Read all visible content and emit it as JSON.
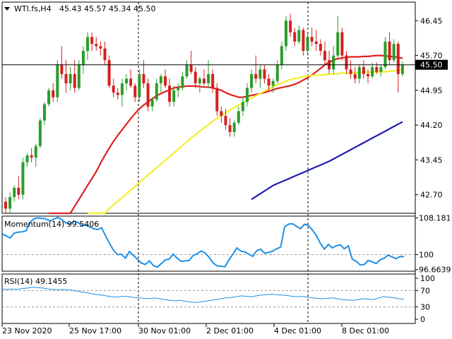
{
  "header": {
    "title": "WTI.fs,H4",
    "quote": "45.43 45.57 45.34 45.50"
  },
  "colors": {
    "bull": "#2a9d2a",
    "bear": "#d42020",
    "ma_fast": "#e02020",
    "ma_mid": "#f2ef2a",
    "ma_slow": "#1c1cb4",
    "indicator": "#1e90e6",
    "grid": "#000000",
    "level": "#9a9a9a"
  },
  "chart_data": [
    {
      "type": "candlestick",
      "title": "WTI.fs,H4",
      "ylim": [
        42.3,
        46.85
      ],
      "y_ticks": [
        "46.45",
        "45.70",
        "44.95",
        "44.20",
        "43.45",
        "42.70"
      ],
      "current_price": "45.50",
      "candles": [
        [
          42.55,
          42.65,
          42.3,
          42.4
        ],
        [
          42.4,
          42.75,
          42.3,
          42.65
        ],
        [
          42.65,
          42.9,
          42.55,
          42.85
        ],
        [
          42.85,
          43.1,
          42.6,
          42.7
        ],
        [
          42.7,
          43.5,
          42.6,
          43.4
        ],
        [
          43.4,
          43.6,
          43.3,
          43.55
        ],
        [
          43.55,
          43.7,
          43.4,
          43.5
        ],
        [
          43.5,
          43.8,
          43.3,
          43.75
        ],
        [
          43.75,
          44.35,
          43.7,
          44.3
        ],
        [
          44.3,
          44.7,
          44.2,
          44.65
        ],
        [
          44.65,
          45.0,
          44.6,
          44.95
        ],
        [
          44.95,
          45.1,
          44.7,
          44.8
        ],
        [
          44.8,
          45.6,
          44.7,
          45.5
        ],
        [
          45.5,
          45.9,
          45.2,
          45.3
        ],
        [
          45.3,
          45.6,
          44.9,
          45.1
        ],
        [
          45.1,
          45.45,
          44.95,
          45.3
        ],
        [
          45.3,
          45.6,
          44.9,
          45.0
        ],
        [
          45.0,
          45.6,
          44.95,
          45.5
        ],
        [
          45.5,
          45.9,
          45.3,
          45.8
        ],
        [
          45.8,
          46.2,
          45.6,
          46.1
        ],
        [
          46.1,
          46.2,
          45.8,
          45.95
        ],
        [
          45.95,
          46.1,
          45.8,
          45.9
        ],
        [
          45.9,
          46.0,
          45.7,
          45.85
        ],
        [
          45.85,
          46.0,
          45.5,
          45.6
        ],
        [
          45.6,
          45.7,
          45.0,
          45.05
        ],
        [
          45.05,
          45.2,
          44.8,
          44.9
        ],
        [
          44.9,
          45.0,
          44.75,
          44.85
        ],
        [
          44.85,
          45.2,
          44.6,
          45.1
        ],
        [
          45.1,
          45.3,
          44.95,
          45.2
        ],
        [
          45.2,
          45.4,
          45.0,
          45.05
        ],
        [
          45.05,
          45.1,
          44.7,
          44.8
        ],
        [
          44.8,
          45.4,
          44.7,
          45.3
        ],
        [
          45.3,
          45.6,
          45.0,
          45.1
        ],
        [
          45.1,
          45.2,
          44.5,
          44.6
        ],
        [
          44.6,
          44.8,
          44.5,
          44.75
        ],
        [
          44.75,
          45.2,
          44.7,
          45.1
        ],
        [
          45.1,
          45.3,
          44.9,
          45.25
        ],
        [
          45.25,
          45.4,
          45.0,
          45.05
        ],
        [
          45.05,
          45.2,
          44.6,
          44.7
        ],
        [
          44.7,
          45.05,
          44.6,
          44.95
        ],
        [
          44.95,
          45.1,
          44.8,
          45.0
        ],
        [
          45.0,
          45.35,
          44.95,
          45.25
        ],
        [
          45.25,
          45.6,
          45.2,
          45.5
        ],
        [
          45.5,
          45.8,
          45.3,
          45.35
        ],
        [
          45.35,
          45.45,
          45.0,
          45.1
        ],
        [
          45.1,
          45.25,
          44.9,
          45.2
        ],
        [
          45.2,
          45.4,
          45.05,
          45.1
        ],
        [
          45.1,
          45.6,
          45.0,
          45.3
        ],
        [
          45.3,
          45.4,
          44.9,
          45.0
        ],
        [
          45.0,
          45.1,
          44.4,
          44.5
        ],
        [
          44.5,
          44.6,
          44.25,
          44.4
        ],
        [
          44.4,
          44.55,
          44.1,
          44.2
        ],
        [
          44.2,
          44.35,
          43.95,
          44.05
        ],
        [
          44.05,
          44.3,
          43.95,
          44.25
        ],
        [
          44.25,
          44.6,
          44.2,
          44.5
        ],
        [
          44.5,
          44.8,
          44.4,
          44.7
        ],
        [
          44.7,
          45.1,
          44.6,
          45.0
        ],
        [
          45.0,
          45.4,
          44.9,
          45.3
        ],
        [
          45.3,
          45.7,
          45.1,
          45.2
        ],
        [
          45.2,
          45.5,
          45.0,
          45.4
        ],
        [
          45.4,
          45.5,
          45.1,
          45.2
        ],
        [
          45.2,
          45.3,
          44.95,
          45.05
        ],
        [
          45.05,
          45.2,
          44.9,
          45.15
        ],
        [
          45.15,
          45.6,
          45.1,
          45.5
        ],
        [
          45.5,
          46.0,
          45.4,
          45.9
        ],
        [
          45.9,
          46.55,
          45.8,
          46.45
        ],
        [
          46.45,
          46.6,
          46.1,
          46.2
        ],
        [
          46.2,
          46.3,
          45.9,
          46.0
        ],
        [
          46.0,
          46.35,
          45.95,
          46.25
        ],
        [
          46.25,
          46.3,
          45.7,
          45.8
        ],
        [
          45.8,
          46.2,
          45.7,
          46.1
        ],
        [
          46.1,
          46.3,
          45.9,
          46.0
        ],
        [
          46.0,
          46.25,
          45.8,
          45.95
        ],
        [
          45.95,
          46.05,
          45.7,
          45.8
        ],
        [
          45.8,
          46.0,
          45.5,
          45.6
        ],
        [
          45.6,
          45.8,
          45.3,
          45.4
        ],
        [
          45.4,
          45.9,
          45.3,
          45.7
        ],
        [
          45.7,
          46.55,
          45.65,
          46.2
        ],
        [
          46.2,
          46.3,
          45.6,
          45.7
        ],
        [
          45.7,
          45.8,
          45.3,
          45.4
        ],
        [
          45.4,
          45.6,
          45.2,
          45.3
        ],
        [
          45.3,
          45.45,
          45.1,
          45.2
        ],
        [
          45.2,
          45.5,
          45.1,
          45.45
        ],
        [
          45.45,
          45.6,
          45.2,
          45.3
        ],
        [
          45.3,
          45.4,
          45.1,
          45.25
        ],
        [
          45.25,
          45.55,
          45.2,
          45.45
        ],
        [
          45.45,
          45.55,
          45.3,
          45.35
        ],
        [
          45.35,
          45.5,
          45.25,
          45.45
        ],
        [
          45.45,
          46.1,
          45.4,
          46.0
        ],
        [
          46.0,
          46.2,
          45.5,
          45.6
        ],
        [
          45.6,
          46.05,
          45.55,
          45.95
        ],
        [
          45.95,
          46.0,
          44.9,
          45.3
        ],
        [
          45.3,
          45.57,
          45.25,
          45.5
        ]
      ],
      "series": [
        {
          "type": "line",
          "values": [
            41.8,
            41.9,
            42.0,
            42.1,
            42.2,
            42.3,
            42.45,
            42.6,
            42.75,
            42.9,
            43.05,
            43.2,
            43.38,
            43.55,
            43.7,
            43.85,
            43.98,
            44.1,
            44.22,
            44.34,
            44.45,
            44.55,
            44.63,
            44.7,
            44.77,
            44.83,
            44.88,
            44.92,
            44.96,
            45.0,
            45.02,
            45.03,
            45.04,
            45.04,
            45.04,
            45.03,
            45.02,
            45.02,
            45.0,
            44.98,
            44.95,
            44.9,
            44.86,
            44.83,
            44.8,
            44.8,
            44.82,
            44.84,
            44.86,
            44.88,
            44.9,
            44.93,
            44.96,
            44.99,
            45.01,
            45.03,
            45.05,
            45.08,
            45.12,
            45.17,
            45.22,
            45.28,
            45.35,
            45.42,
            45.5,
            45.55,
            45.6,
            45.63,
            45.65,
            45.66,
            45.67,
            45.67,
            45.67,
            45.68,
            45.68,
            45.69,
            45.7,
            45.7,
            45.69,
            45.68,
            45.67,
            45.66,
            45.64
          ]
        },
        {
          "type": "line",
          "values": [
            41.9,
            42.0,
            42.1,
            42.2,
            42.3,
            42.4,
            42.48,
            42.56,
            42.64,
            42.72,
            42.8,
            42.88,
            42.96,
            43.04,
            43.12,
            43.2,
            43.28,
            43.36,
            43.44,
            43.52,
            43.6,
            43.68,
            43.76,
            43.84,
            43.92,
            44.0,
            44.07,
            44.14,
            44.21,
            44.28,
            44.35,
            44.41,
            44.47,
            44.53,
            44.58,
            44.63,
            44.68,
            44.73,
            44.78,
            44.83,
            44.88,
            44.93,
            44.98,
            45.03,
            45.07,
            45.11,
            45.15,
            45.18,
            45.2,
            45.22,
            45.24,
            45.26,
            45.27,
            45.28,
            45.28,
            45.29,
            45.3,
            45.3,
            45.31,
            45.32,
            45.32,
            45.33,
            45.33,
            45.33,
            45.34,
            45.34,
            45.34,
            45.34,
            45.35,
            45.35,
            45.36,
            45.37,
            45.38,
            45.4
          ]
        },
        {
          "type": "line",
          "values": [
            42.6,
            42.66,
            42.72,
            42.78,
            42.84,
            42.9,
            42.94,
            42.98,
            43.02,
            43.06,
            43.1,
            43.14,
            43.18,
            43.22,
            43.26,
            43.3,
            43.34,
            43.38,
            43.42,
            43.47,
            43.52,
            43.57,
            43.62,
            43.67,
            43.72,
            43.77,
            43.82,
            43.87,
            43.92,
            43.97,
            44.02,
            44.07,
            44.12,
            44.17,
            44.22,
            44.27
          ]
        }
      ],
      "x_ticks": [
        "23 Nov 2020",
        "25 Nov 17:00",
        "30 Nov 01:00",
        "2 Dec 01:00",
        "4 Dec 01:00",
        "8 Dec 01:00"
      ]
    },
    {
      "type": "line",
      "title": "Momentum(14) 99.5406",
      "ylim": [
        96.3,
        108.6
      ],
      "y_ticks": [
        "108.181",
        "100",
        "96.6639"
      ],
      "level": 100,
      "values": [
        104.6,
        104.2,
        103.7,
        104.8,
        105.0,
        105.1,
        105.3,
        107.2,
        108.0,
        108.2,
        108.1,
        108.0,
        107.5,
        107.9,
        108.3,
        107.8,
        107.1,
        106.8,
        107.5,
        107.2,
        106.5,
        106.6,
        106.2,
        105.8,
        105.6,
        106.0,
        104.2,
        102.5,
        101.0,
        100.0,
        100.1,
        99.2,
        100.7,
        99.8,
        99.0,
        98.1,
        97.8,
        98.6,
        97.6,
        97.2,
        98.0,
        98.8,
        99.0,
        100.1,
        99.2,
        98.5,
        98.6,
        98.7,
        99.8,
        100.2,
        100.8,
        100.4,
        99.4,
        98.2,
        97.5,
        97.4,
        97.3,
        98.8,
        100.1,
        101.5,
        100.8,
        100.6,
        100.1,
        99.6,
        100.9,
        101.2,
        100.3,
        100.5,
        100.8,
        101.3,
        101.7,
        106.2,
        106.8,
        106.9,
        106.3,
        105.8,
        106.8,
        106.5,
        105.5,
        104.2,
        102.5,
        101.2,
        102.3,
        101.5,
        102.0,
        102.2,
        101.3,
        102.0,
        99.0,
        98.5,
        97.7,
        97.8,
        98.7,
        98.4,
        98.0,
        98.8,
        99.2,
        99.9,
        99.5,
        99.1,
        99.6,
        99.54
      ]
    },
    {
      "type": "line",
      "title": "RSI(14) 49.1455",
      "ylim": [
        0,
        100
      ],
      "y_ticks": [
        "100",
        "70",
        "30",
        "0"
      ],
      "levels": [
        70,
        30
      ],
      "values": [
        74,
        73,
        74,
        73,
        75,
        76,
        78,
        77,
        76,
        74,
        73,
        72,
        73,
        72,
        70,
        68,
        66,
        64,
        61,
        60,
        58,
        56,
        54,
        55,
        56,
        55,
        53,
        52,
        51,
        50,
        52,
        50,
        48,
        46,
        45,
        46,
        44,
        42,
        41,
        42,
        44,
        46,
        48,
        50,
        52,
        53,
        55,
        57,
        56,
        55,
        57,
        59,
        60,
        61,
        60,
        59,
        58,
        56,
        55,
        56,
        54,
        52,
        51,
        50,
        51,
        52,
        50,
        48,
        47,
        46,
        48,
        50,
        49,
        48,
        52,
        55,
        54,
        52,
        50,
        49
      ]
    }
  ]
}
